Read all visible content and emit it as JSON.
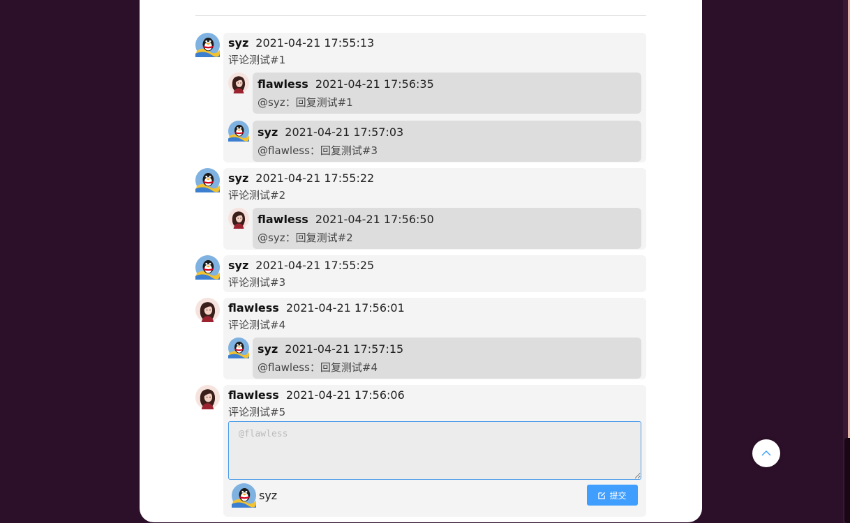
{
  "comments": [
    {
      "user": "syz",
      "avatar": "penguin-avatar-icon",
      "time": "2021-04-21 17:55:13",
      "text": "评论测试#1",
      "replies": [
        {
          "user": "flawless",
          "avatar": "girl-avatar-icon",
          "time": "2021-04-21 17:56:35",
          "text": "@syz：回复测试#1"
        },
        {
          "user": "syz",
          "avatar": "penguin-avatar-icon",
          "time": "2021-04-21 17:57:03",
          "text": "@flawless：回复测试#3"
        }
      ]
    },
    {
      "user": "syz",
      "avatar": "penguin-avatar-icon",
      "time": "2021-04-21 17:55:22",
      "text": "评论测试#2",
      "replies": [
        {
          "user": "flawless",
          "avatar": "girl-avatar-icon",
          "time": "2021-04-21 17:56:50",
          "text": "@syz：回复测试#2"
        }
      ]
    },
    {
      "user": "syz",
      "avatar": "penguin-avatar-icon",
      "time": "2021-04-21 17:55:25",
      "text": "评论测试#3",
      "replies": []
    },
    {
      "user": "flawless",
      "avatar": "girl-avatar-icon",
      "time": "2021-04-21 17:56:01",
      "text": "评论测试#4",
      "replies": [
        {
          "user": "syz",
          "avatar": "penguin-avatar-icon",
          "time": "2021-04-21 17:57:15",
          "text": "@flawless：回复测试#4"
        }
      ]
    },
    {
      "user": "flawless",
      "avatar": "girl-avatar-icon",
      "time": "2021-04-21 17:56:06",
      "text": "评论测试#5",
      "replies": []
    }
  ],
  "editor": {
    "placeholder": "@flawless",
    "value": "",
    "current_user": "syz",
    "current_avatar": "penguin-avatar-icon",
    "submit_label": "提交",
    "submit_icon": "edit-icon"
  },
  "back_to_top_icon": "chevron-up-icon",
  "colors": {
    "background": "#2c0f28",
    "accent": "#409eff",
    "comment_bg": "#f4f4f4",
    "reply_bg": "#dddddd"
  }
}
